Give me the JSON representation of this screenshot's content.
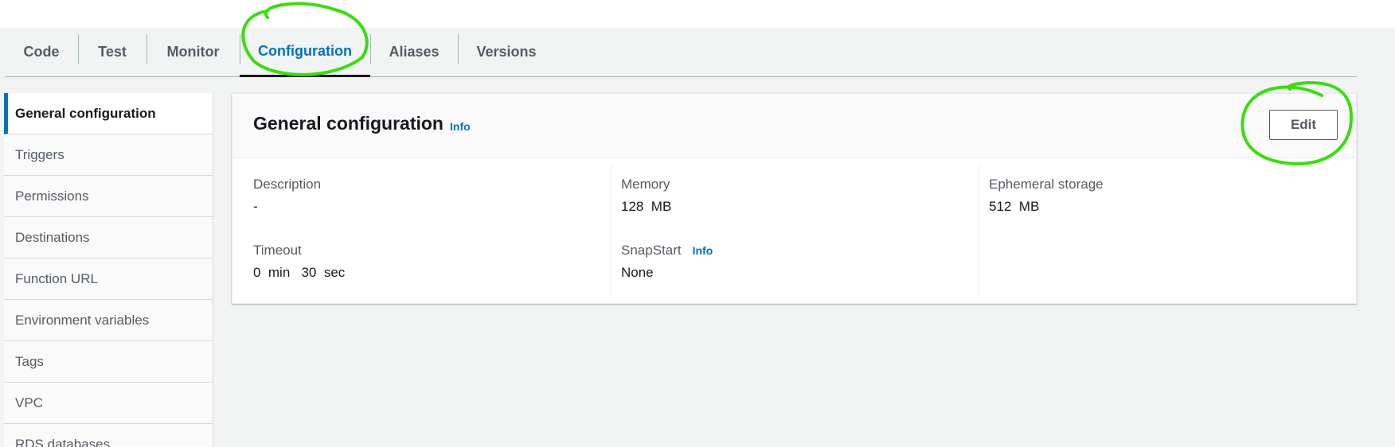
{
  "tabs": [
    {
      "label": "Code"
    },
    {
      "label": "Test"
    },
    {
      "label": "Monitor"
    },
    {
      "label": "Configuration",
      "active": true
    },
    {
      "label": "Aliases"
    },
    {
      "label": "Versions"
    }
  ],
  "sidebar": {
    "items": [
      {
        "label": "General configuration",
        "active": true
      },
      {
        "label": "Triggers"
      },
      {
        "label": "Permissions"
      },
      {
        "label": "Destinations"
      },
      {
        "label": "Function URL"
      },
      {
        "label": "Environment variables"
      },
      {
        "label": "Tags"
      },
      {
        "label": "VPC"
      },
      {
        "label": "RDS databases"
      }
    ]
  },
  "panel": {
    "title": "General configuration",
    "info_label": "Info",
    "edit_label": "Edit",
    "fields": {
      "description": {
        "label": "Description",
        "value": "-"
      },
      "memory": {
        "label": "Memory",
        "value": "128  MB"
      },
      "ephemeral_storage": {
        "label": "Ephemeral storage",
        "value": "512  MB"
      },
      "timeout": {
        "label": "Timeout",
        "value": "0  min   30  sec"
      },
      "snapstart": {
        "label": "SnapStart",
        "info_label": "Info",
        "value": "None"
      }
    }
  },
  "colors": {
    "accent": "#0073bb",
    "annotation": "#3bdc10"
  }
}
